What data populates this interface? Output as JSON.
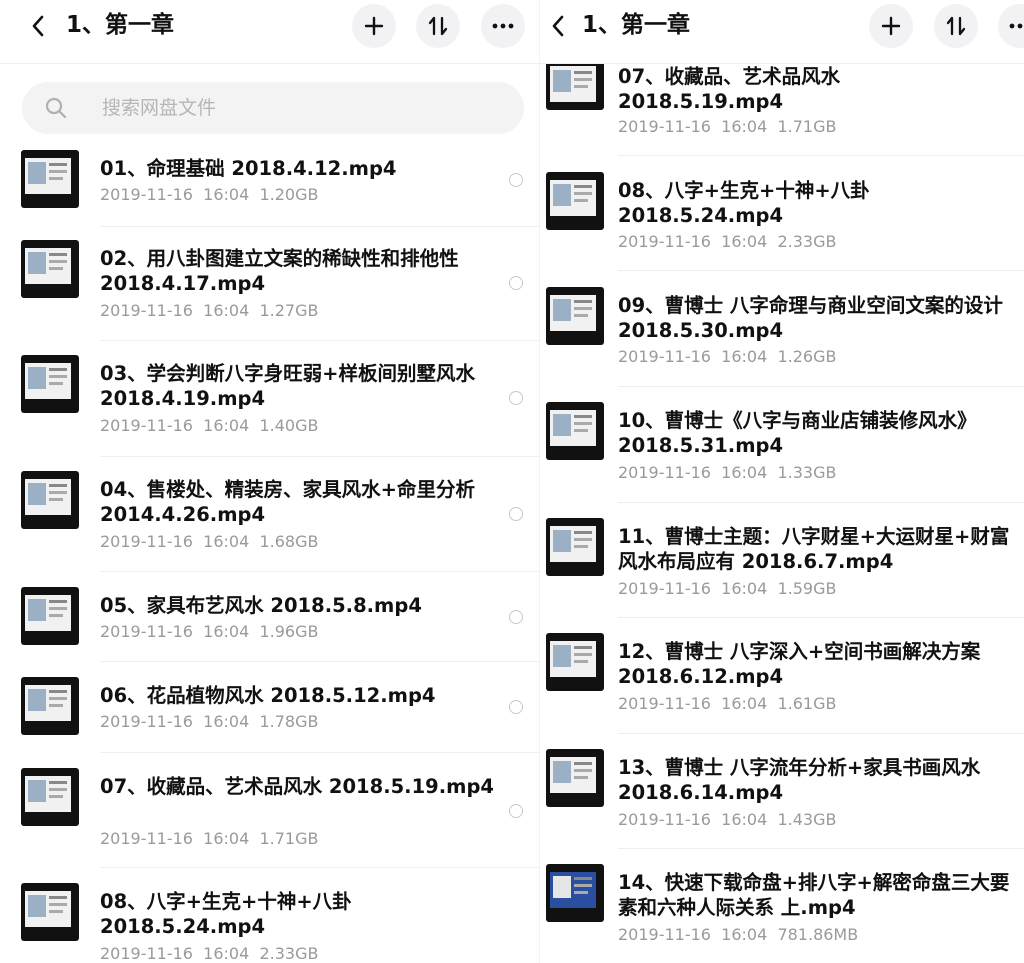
{
  "left": {
    "title": "1、第一章",
    "search_placeholder": "搜索网盘文件",
    "items": [
      {
        "name": "01、命理基础 2018.4.12.mp4",
        "meta": "2019-11-16  16:04  1.20GB"
      },
      {
        "name": "02、用八卦图建立文案的稀缺性和排他性 2018.4.17.mp4",
        "meta": "2019-11-16  16:04  1.27GB"
      },
      {
        "name": "03、学会判断八字身旺弱+样板间别墅风水 2018.4.19.mp4",
        "meta": "2019-11-16  16:04  1.40GB"
      },
      {
        "name": "04、售楼处、精装房、家具风水+命里分析 2014.4.26.mp4",
        "meta": "2019-11-16  16:04  1.68GB"
      },
      {
        "name": "05、家具布艺风水 2018.5.8.mp4",
        "meta": "2019-11-16  16:04  1.96GB"
      },
      {
        "name": "06、花品植物风水 2018.5.12.mp4",
        "meta": "2019-11-16  16:04  1.78GB"
      },
      {
        "name": "07、收藏品、艺术品风水 2018.5.19.mp4",
        "meta": "2019-11-16  16:04  1.71GB"
      },
      {
        "name": "08、八字+生克+十神+八卦 2018.5.24.mp4",
        "meta": "2019-11-16  16:04  2.33GB"
      }
    ]
  },
  "right": {
    "title": "1、第一章",
    "items": [
      {
        "name": "07、收藏品、艺术品风水 2018.5.19.mp4",
        "meta": "2019-11-16  16:04  1.71GB"
      },
      {
        "name": "08、八字+生克+十神+八卦 2018.5.24.mp4",
        "meta": "2019-11-16  16:04  2.33GB"
      },
      {
        "name": "09、曹博士 八字命理与商业空间文案的设计 2018.5.30.mp4",
        "meta": "2019-11-16  16:04  1.26GB"
      },
      {
        "name": "10、曹博士《八字与商业店铺装修风水》2018.5.31.mp4",
        "meta": "2019-11-16  16:04  1.33GB"
      },
      {
        "name": "11、曹博士主题：八字财星+大运财星+财富风水布局应有 2018.6.7.mp4",
        "meta": "2019-11-16  16:04  1.59GB"
      },
      {
        "name": "12、曹博士 八字深入+空间书画解决方案 2018.6.12.mp4",
        "meta": "2019-11-16  16:04  1.61GB"
      },
      {
        "name": "13、曹博士 八字流年分析+家具书画风水 2018.6.14.mp4",
        "meta": "2019-11-16  16:04  1.43GB"
      },
      {
        "name": "14、快速下载命盘+排八字+解密命盘三大要素和六种人际关系 上.mp4",
        "meta": "2019-11-16  16:04  781.86MB"
      }
    ]
  },
  "icons": {
    "back": "chevron-left-icon",
    "add": "plus-icon",
    "sort": "sort-icon",
    "more": "more-horizontal-icon",
    "search": "search-icon"
  },
  "colors": {
    "text": "#111111",
    "meta": "#9a9a9a",
    "button_bg": "#f2f2f4",
    "search_bg": "#f3f3f3"
  }
}
